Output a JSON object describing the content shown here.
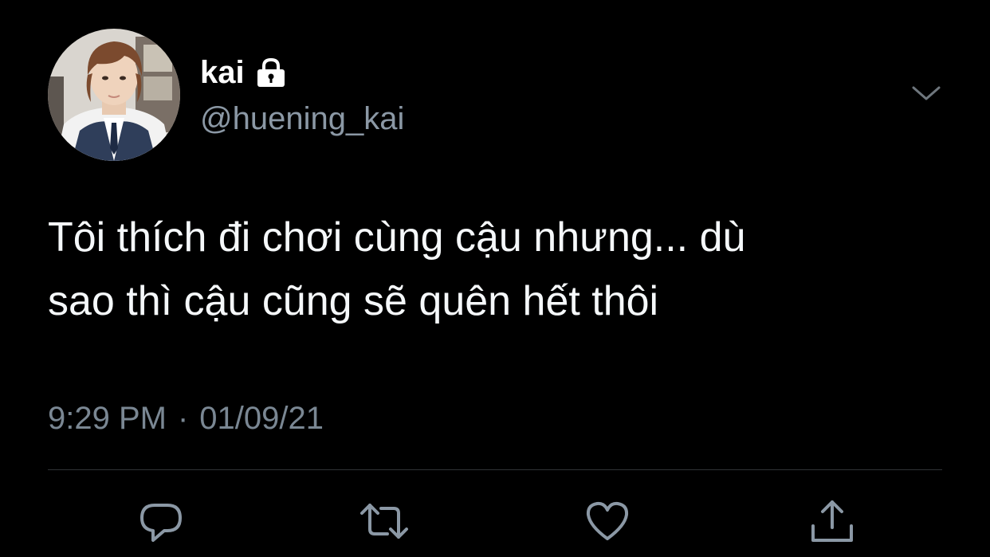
{
  "tweet": {
    "display_name": "kai",
    "handle": "@huening_kai",
    "text_line1": "Tôi thích đi chơi cùng cậu nhưng... dù",
    "text_line2": "sao thì cậu cũng sẽ quên hết thôi",
    "time": "9:29 PM",
    "separator": "·",
    "date": "01/09/21",
    "protected": true
  },
  "icons": {
    "lock": "lock-icon",
    "more": "chevron-down-icon",
    "reply": "reply-icon",
    "retweet": "retweet-icon",
    "like": "heart-icon",
    "share": "share-icon"
  },
  "colors": {
    "background": "#000000",
    "text": "#f5f8fa",
    "secondary": "#8b98a5",
    "divider": "#2f3336"
  }
}
